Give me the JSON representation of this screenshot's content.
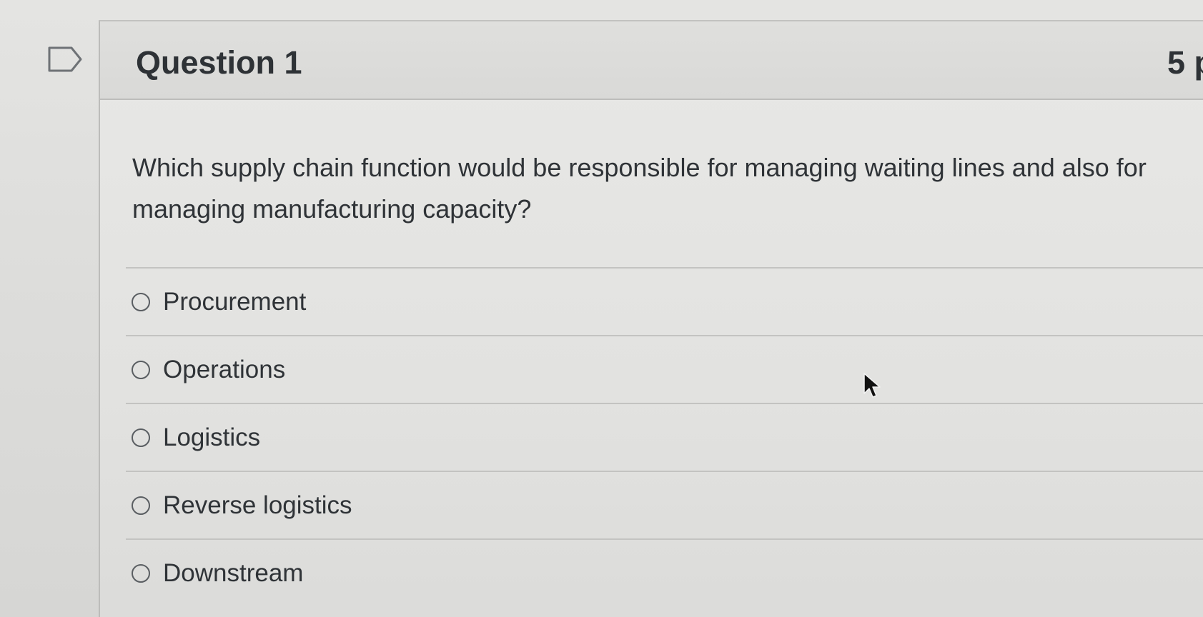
{
  "question": {
    "title": "Question 1",
    "points": "5 p",
    "text": "Which supply chain function would be responsible for managing waiting lines and also for managing manufacturing capacity?"
  },
  "answers": [
    {
      "label": "Procurement",
      "selected": false
    },
    {
      "label": "Operations",
      "selected": false
    },
    {
      "label": "Logistics",
      "selected": false
    },
    {
      "label": "Reverse logistics",
      "selected": false
    },
    {
      "label": "Downstream",
      "selected": false
    }
  ],
  "icons": {
    "flag": "flag-question-icon",
    "cursor": "mouse-pointer-icon"
  },
  "colors": {
    "text": "#2f3337",
    "background": "#e2e2e0",
    "divider": "#c3c3c1"
  }
}
